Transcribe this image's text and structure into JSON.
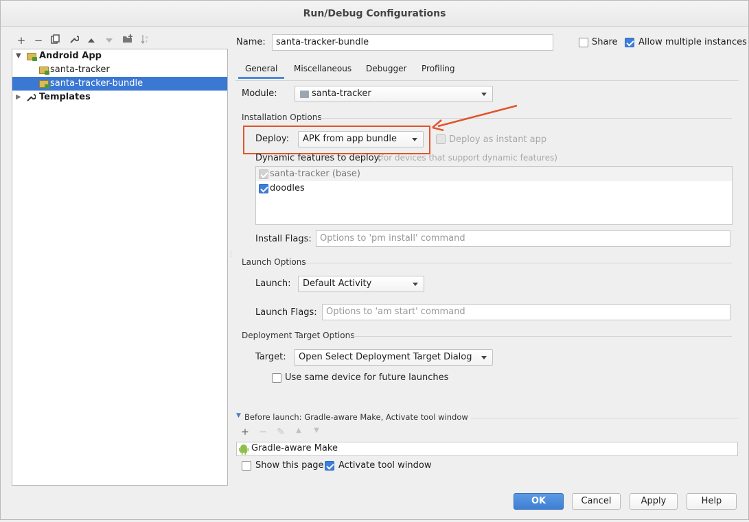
{
  "window": {
    "title": "Run/Debug Configurations"
  },
  "colors": {
    "accent": "#3a78d3",
    "highlight": "#e2542b",
    "android_green": "#8cc04b"
  },
  "toolbar": {
    "icons": [
      "plus-icon",
      "minus-icon",
      "copy-icon",
      "wrench-icon",
      "arrow-up-icon",
      "arrow-down-icon",
      "folder-add-icon",
      "sort-icon"
    ]
  },
  "tree": {
    "android_app": "Android App",
    "items": [
      {
        "label": "santa-tracker"
      },
      {
        "label": "santa-tracker-bundle"
      }
    ],
    "templates": "Templates"
  },
  "header": {
    "name_label": "Name:",
    "name_value": "santa-tracker-bundle",
    "share_label": "Share",
    "share_checked": false,
    "allow_multiple_label": "Allow multiple instances",
    "allow_multiple_checked": true
  },
  "tabs": [
    {
      "label": "General"
    },
    {
      "label": "Miscellaneous"
    },
    {
      "label": "Debugger"
    },
    {
      "label": "Profiling"
    }
  ],
  "general": {
    "module_label": "Module:",
    "module_value": "santa-tracker",
    "installation_title": "Installation Options",
    "deploy_label": "Deploy:",
    "deploy_value": "APK from app bundle",
    "instant_app_label": "Deploy as instant app",
    "dynamic_label": "Dynamic features to deploy:",
    "dynamic_hint": "(for devices that support dynamic features)",
    "features": [
      {
        "label": "santa-tracker (base)",
        "checked": true,
        "disabled": true
      },
      {
        "label": "doodles",
        "checked": true,
        "disabled": false
      }
    ],
    "install_flags_label": "Install Flags:",
    "install_flags_placeholder": "Options to 'pm install' command",
    "launch_title": "Launch Options",
    "launch_label": "Launch:",
    "launch_value": "Default Activity",
    "launch_flags_label": "Launch Flags:",
    "launch_flags_placeholder": "Options to 'am start' command",
    "deployment_title": "Deployment Target Options",
    "target_label": "Target:",
    "target_value": "Open Select Deployment Target Dialog",
    "same_device_label": "Use same device for future launches",
    "same_device_checked": false
  },
  "before_launch": {
    "title": "Before launch: Gradle-aware Make, Activate tool window",
    "item": "Gradle-aware Make",
    "show_page_label": "Show this page",
    "show_page_checked": false,
    "activate_label": "Activate tool window",
    "activate_checked": true
  },
  "buttons": {
    "ok": "OK",
    "cancel": "Cancel",
    "apply": "Apply",
    "help": "Help"
  }
}
